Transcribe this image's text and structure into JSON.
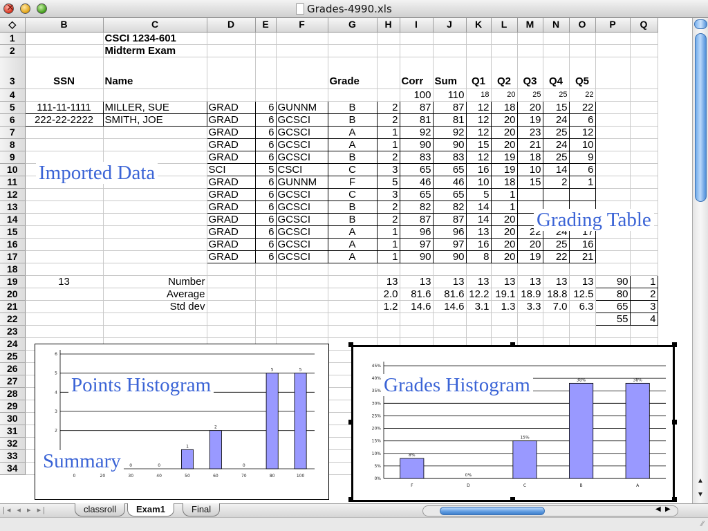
{
  "window": {
    "title": "Grades-4990.xls"
  },
  "columns": [
    "◇",
    "B",
    "C",
    "D",
    "E",
    "F",
    "G",
    "H",
    "I",
    "J",
    "K",
    "L",
    "M",
    "N",
    "O",
    "P",
    "Q"
  ],
  "sheet": {
    "title1": "CSCI 1234-601",
    "title2": "Midterm Exam",
    "headers": {
      "ssn": "SSN",
      "name": "Name",
      "grade": "Grade",
      "corr": "Corr",
      "sum": "Sum",
      "q1": "Q1",
      "q2": "Q2",
      "q3": "Q3",
      "q4": "Q4",
      "q5": "Q5"
    },
    "maxes": {
      "corr": "100",
      "sum": "110",
      "q1": "18",
      "q2": "20",
      "q3": "25",
      "q4": "25",
      "q5": "22"
    },
    "students": [
      {
        "ssn": "111-11-1111",
        "name": "MILLER, SUE",
        "status": "GRAD",
        "level": "6",
        "prog": "GUNNM",
        "grade": "B",
        "gp": "2",
        "corr": "87",
        "sum": "87",
        "q": [
          "12",
          "18",
          "20",
          "15",
          "22"
        ]
      },
      {
        "ssn": "222-22-2222",
        "name": "SMITH, JOE",
        "status": "GRAD",
        "level": "6",
        "prog": "GCSCI",
        "grade": "B",
        "gp": "2",
        "corr": "81",
        "sum": "81",
        "q": [
          "12",
          "20",
          "19",
          "24",
          "6"
        ]
      },
      {
        "ssn": "",
        "name": "",
        "status": "GRAD",
        "level": "6",
        "prog": "GCSCI",
        "grade": "A",
        "gp": "1",
        "corr": "92",
        "sum": "92",
        "q": [
          "12",
          "20",
          "23",
          "25",
          "12"
        ]
      },
      {
        "ssn": "",
        "name": "",
        "status": "GRAD",
        "level": "6",
        "prog": "GCSCI",
        "grade": "A",
        "gp": "1",
        "corr": "90",
        "sum": "90",
        "q": [
          "15",
          "20",
          "21",
          "24",
          "10"
        ]
      },
      {
        "ssn": "",
        "name": "",
        "status": "GRAD",
        "level": "6",
        "prog": "GCSCI",
        "grade": "B",
        "gp": "2",
        "corr": "83",
        "sum": "83",
        "q": [
          "12",
          "19",
          "18",
          "25",
          "9"
        ]
      },
      {
        "ssn": "",
        "name": "",
        "status": "SCI",
        "level": "5",
        "prog": "CSCI",
        "grade": "C",
        "gp": "3",
        "corr": "65",
        "sum": "65",
        "q": [
          "16",
          "19",
          "10",
          "14",
          "6"
        ]
      },
      {
        "ssn": "",
        "name": "",
        "status": "GRAD",
        "level": "6",
        "prog": "GUNNM",
        "grade": "F",
        "gp": "5",
        "corr": "46",
        "sum": "46",
        "q": [
          "10",
          "18",
          "15",
          "2",
          "1"
        ]
      },
      {
        "ssn": "",
        "name": "",
        "status": "GRAD",
        "level": "6",
        "prog": "GCSCI",
        "grade": "C",
        "gp": "3",
        "corr": "65",
        "sum": "65",
        "q": [
          "5",
          "1",
          "",
          "",
          ""
        ]
      },
      {
        "ssn": "",
        "name": "",
        "status": "GRAD",
        "level": "6",
        "prog": "GCSCI",
        "grade": "B",
        "gp": "2",
        "corr": "82",
        "sum": "82",
        "q": [
          "14",
          "1",
          "",
          "",
          ""
        ]
      },
      {
        "ssn": "",
        "name": "",
        "status": "GRAD",
        "level": "6",
        "prog": "GCSCI",
        "grade": "B",
        "gp": "2",
        "corr": "87",
        "sum": "87",
        "q": [
          "14",
          "20",
          "",
          "",
          ""
        ]
      },
      {
        "ssn": "",
        "name": "",
        "status": "GRAD",
        "level": "6",
        "prog": "GCSCI",
        "grade": "A",
        "gp": "1",
        "corr": "96",
        "sum": "96",
        "q": [
          "13",
          "20",
          "22",
          "24",
          "17"
        ]
      },
      {
        "ssn": "",
        "name": "",
        "status": "GRAD",
        "level": "6",
        "prog": "GCSCI",
        "grade": "A",
        "gp": "1",
        "corr": "97",
        "sum": "97",
        "q": [
          "16",
          "20",
          "20",
          "25",
          "16"
        ]
      },
      {
        "ssn": "",
        "name": "",
        "status": "GRAD",
        "level": "6",
        "prog": "GCSCI",
        "grade": "A",
        "gp": "1",
        "corr": "90",
        "sum": "90",
        "q": [
          "8",
          "20",
          "19",
          "22",
          "21"
        ]
      }
    ],
    "summary": {
      "count": "13",
      "rows": [
        {
          "label": "Number",
          "h": "13",
          "i": "13",
          "j": "13",
          "k": "13",
          "l": "13",
          "m": "13",
          "n": "13",
          "o": "13",
          "p": "90",
          "q": "1"
        },
        {
          "label": "Average",
          "h": "2.0",
          "i": "81.6",
          "j": "81.6",
          "k": "12.2",
          "l": "19.1",
          "m": "18.9",
          "n": "18.8",
          "o": "12.5",
          "p": "80",
          "q": "2"
        },
        {
          "label": "Std dev",
          "h": "1.2",
          "i": "14.6",
          "j": "14.6",
          "k": "3.1",
          "l": "1.3",
          "m": "3.3",
          "n": "7.0",
          "o": "6.3",
          "p": "65",
          "q": "3"
        }
      ],
      "row22": {
        "p": "55",
        "q": "4"
      }
    }
  },
  "overlays": {
    "imported": "Imported Data",
    "grading": "Grading Table",
    "points": "Points Histogram",
    "grades": "Grades Histogram",
    "summary": "Summary"
  },
  "tabs": [
    "classroll",
    "Exam1",
    "Final"
  ],
  "tab_nav": "|◂ ◂ ▸ ▸|",
  "chart_data": [
    {
      "type": "bar",
      "categories": [
        "0",
        "20",
        "30",
        "40",
        "50",
        "60",
        "70",
        "80",
        "100"
      ],
      "values": [
        0,
        0,
        0,
        0,
        1,
        2,
        0,
        5,
        5
      ],
      "ylim": [
        0,
        6
      ],
      "yticks": [
        2,
        3,
        4,
        5,
        6
      ],
      "color": "#9999ff"
    },
    {
      "type": "bar",
      "categories": [
        "F",
        "D",
        "C",
        "B",
        "A"
      ],
      "values": [
        8,
        0,
        15,
        38,
        38
      ],
      "data_labels": [
        "8%",
        "0%",
        "15%",
        "38%",
        "38%"
      ],
      "ylim": [
        0,
        45
      ],
      "yticks": [
        "0%",
        "5%",
        "10%",
        "15%",
        "20%",
        "25%",
        "30%",
        "35%",
        "40%",
        "45%"
      ],
      "color": "#9999ff"
    }
  ]
}
